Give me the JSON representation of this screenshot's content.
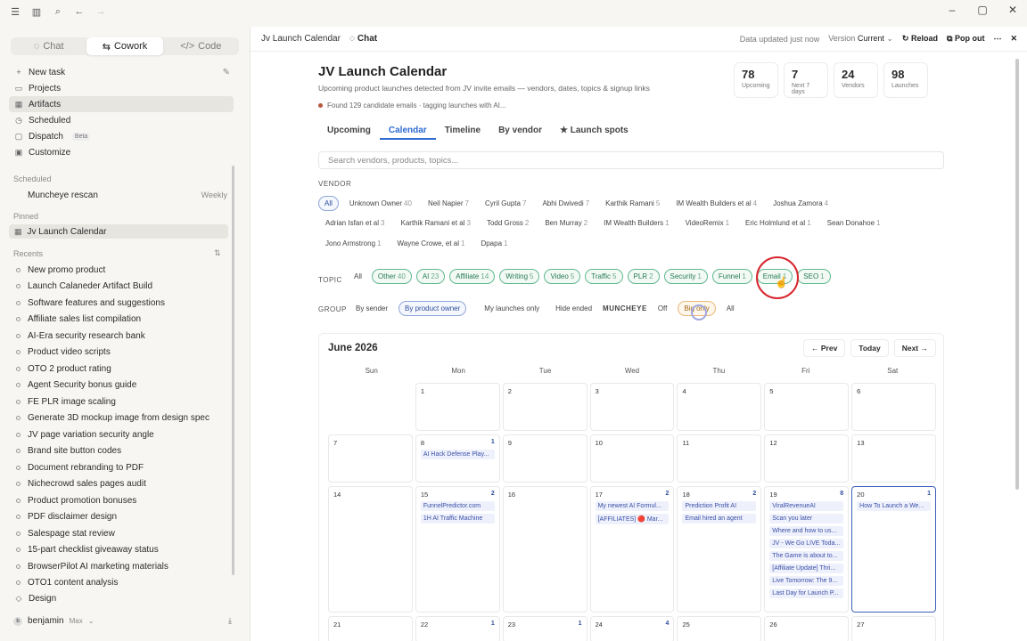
{
  "sidebar": {
    "mode_tabs": [
      {
        "label": "Chat",
        "icon": "chat-bubble-icon"
      },
      {
        "label": "Cowork",
        "icon": "cowork-icon"
      },
      {
        "label": "Code",
        "icon": "code-icon"
      }
    ],
    "nav": [
      {
        "label": "New task",
        "icon": "+"
      },
      {
        "label": "Projects",
        "icon": "▭"
      },
      {
        "label": "Artifacts",
        "icon": "▦"
      },
      {
        "label": "Scheduled",
        "icon": "◷"
      },
      {
        "label": "Dispatch",
        "icon": "▢",
        "badge": "Beta"
      },
      {
        "label": "Customize",
        "icon": "▣"
      }
    ],
    "scheduled_label": "Scheduled",
    "scheduled": {
      "label": "Muncheye rescan",
      "freq": "Weekly"
    },
    "pinned_label": "Pinned",
    "pinned": {
      "label": "Jv Launch Calendar"
    },
    "recents_label": "Recents",
    "recents": [
      "New promo product",
      "Launch Calaneder Artifact Build",
      "Software features and suggestions",
      "Affiliate sales list compilation",
      "AI-Era security research bank",
      "Product video scripts",
      "OTO 2 product rating",
      "Agent Security bonus guide",
      "FE PLR image scaling",
      "Generate 3D mockup image from design spec",
      "JV page variation security angle",
      "Brand site button codes",
      "Document rebranding to PDF",
      "Nichecrowd sales pages audit",
      "Product promotion bonuses",
      "PDF disclaimer design",
      "Salespage stat review",
      "15-part checklist giveaway status",
      "BrowserPilot AI marketing materials",
      "OTO1 content analysis",
      "Design"
    ],
    "user": {
      "name": "benjamin",
      "plan": "Max",
      "initial": "b"
    }
  },
  "topbar": {
    "crumb": "Jv Launch Calendar",
    "chat": "Chat",
    "updated": "Data updated just now",
    "version_label": "Version",
    "version_value": "Current",
    "reload": "Reload",
    "popout": "Pop out"
  },
  "page": {
    "title": "JV Launch Calendar",
    "subtitle": "Upcoming product launches detected from JV invite emails — vendors, dates, topics & signup links",
    "status": "Found 129 candidate emails · tagging launches with AI...",
    "stats": [
      {
        "value": "78",
        "label": "Upcoming"
      },
      {
        "value": "7",
        "label": "Next 7 days"
      },
      {
        "value": "24",
        "label": "Vendors"
      },
      {
        "value": "98",
        "label": "Launches"
      }
    ],
    "tabs": [
      "Upcoming",
      "Calendar",
      "Timeline",
      "By vendor",
      "★ Launch spots"
    ],
    "search_placeholder": "Search vendors, products, topics...",
    "vendor_label": "VENDOR",
    "vendors_row1": [
      {
        "name": "All",
        "count": ""
      },
      {
        "name": "Unknown Owner",
        "count": "40"
      },
      {
        "name": "Neil Napier",
        "count": "7"
      },
      {
        "name": "Cyril Gupta",
        "count": "7"
      },
      {
        "name": "Abhi Dwivedi",
        "count": "7"
      },
      {
        "name": "Karthik Ramani",
        "count": "5"
      },
      {
        "name": "IM Wealth Builders et al",
        "count": "4"
      },
      {
        "name": "Joshua Zamora",
        "count": "4"
      }
    ],
    "vendors_row2": [
      {
        "name": "Adrian Isfan et al",
        "count": "3"
      },
      {
        "name": "Karthik Ramani et al",
        "count": "3"
      },
      {
        "name": "Todd Gross",
        "count": "2"
      },
      {
        "name": "Ben Murray",
        "count": "2"
      },
      {
        "name": "IM Wealth Builders",
        "count": "1"
      },
      {
        "name": "VideoRemix",
        "count": "1"
      },
      {
        "name": "Eric Holmlund et al",
        "count": "1"
      },
      {
        "name": "Sean Donahoe",
        "count": "1"
      }
    ],
    "vendors_row3": [
      {
        "name": "Jono Armstrong",
        "count": "1"
      },
      {
        "name": "Wayne Crowe, et al",
        "count": "1"
      },
      {
        "name": "Dpapa",
        "count": "1"
      }
    ],
    "topic_label": "TOPIC",
    "topics": [
      {
        "name": "All",
        "count": ""
      },
      {
        "name": "Other",
        "count": "40"
      },
      {
        "name": "AI",
        "count": "23"
      },
      {
        "name": "Affiliate",
        "count": "14"
      },
      {
        "name": "Writing",
        "count": "5"
      },
      {
        "name": "Video",
        "count": "5"
      },
      {
        "name": "Traffic",
        "count": "5"
      },
      {
        "name": "PLR",
        "count": "2"
      },
      {
        "name": "Security",
        "count": "1"
      },
      {
        "name": "Funnel",
        "count": "1"
      },
      {
        "name": "Email",
        "count": "1"
      },
      {
        "name": "SEO",
        "count": "1"
      }
    ],
    "group_label": "GROUP",
    "group_opts": [
      "By sender",
      "By product owner",
      "My launches only",
      "Hide ended"
    ],
    "muncheye_label": "MUNCHEYE",
    "muncheye_opts": [
      "Off",
      "Big only",
      "All"
    ]
  },
  "calendar": {
    "month": "June 2026",
    "prev": "← Prev",
    "today": "Today",
    "next": "Next →",
    "dow": [
      "Sun",
      "Mon",
      "Tue",
      "Wed",
      "Thu",
      "Fri",
      "Sat"
    ],
    "weeks": [
      [
        {
          "d": ""
        },
        {
          "d": "1"
        },
        {
          "d": "2"
        },
        {
          "d": "3"
        },
        {
          "d": "4"
        },
        {
          "d": "5"
        },
        {
          "d": "6"
        }
      ],
      [
        {
          "d": "7"
        },
        {
          "d": "8",
          "n": "1",
          "ev": [
            "AI Hack Defense Play..."
          ]
        },
        {
          "d": "9"
        },
        {
          "d": "10"
        },
        {
          "d": "11"
        },
        {
          "d": "12"
        },
        {
          "d": "13"
        }
      ],
      [
        {
          "d": "14"
        },
        {
          "d": "15",
          "n": "2",
          "ev": [
            "FunnelPredictor.com",
            "1H AI Traffic Machine"
          ]
        },
        {
          "d": "16"
        },
        {
          "d": "17",
          "n": "2",
          "ev": [
            "My newest AI Formul...",
            "[AFFILIATES] 🔴 Mar..."
          ]
        },
        {
          "d": "18",
          "n": "2",
          "ev": [
            "Prediction Profit AI",
            "Email hired an agent"
          ]
        },
        {
          "d": "19",
          "n": "8",
          "ev": [
            "ViralRevenueAI",
            "Scan you later",
            "Where and how to us...",
            "JV - We Go LIVE Toda...",
            "The Game is about to...",
            "[Affiliate Update] Thri...",
            "Live Tomorrow: The 9...",
            "Last Day for Launch P..."
          ]
        },
        {
          "d": "20",
          "n": "1",
          "ev": [
            "How To Launch a We..."
          ],
          "today": true
        }
      ],
      [
        {
          "d": "21"
        },
        {
          "d": "22",
          "n": "1"
        },
        {
          "d": "23",
          "n": "1"
        },
        {
          "d": "24",
          "n": "4"
        },
        {
          "d": "25"
        },
        {
          "d": "26"
        },
        {
          "d": "27"
        }
      ]
    ]
  },
  "colors": {
    "accent": "#2d6ad1",
    "topic_green": "#5fb88d",
    "cursor_red": "#d7262e"
  }
}
